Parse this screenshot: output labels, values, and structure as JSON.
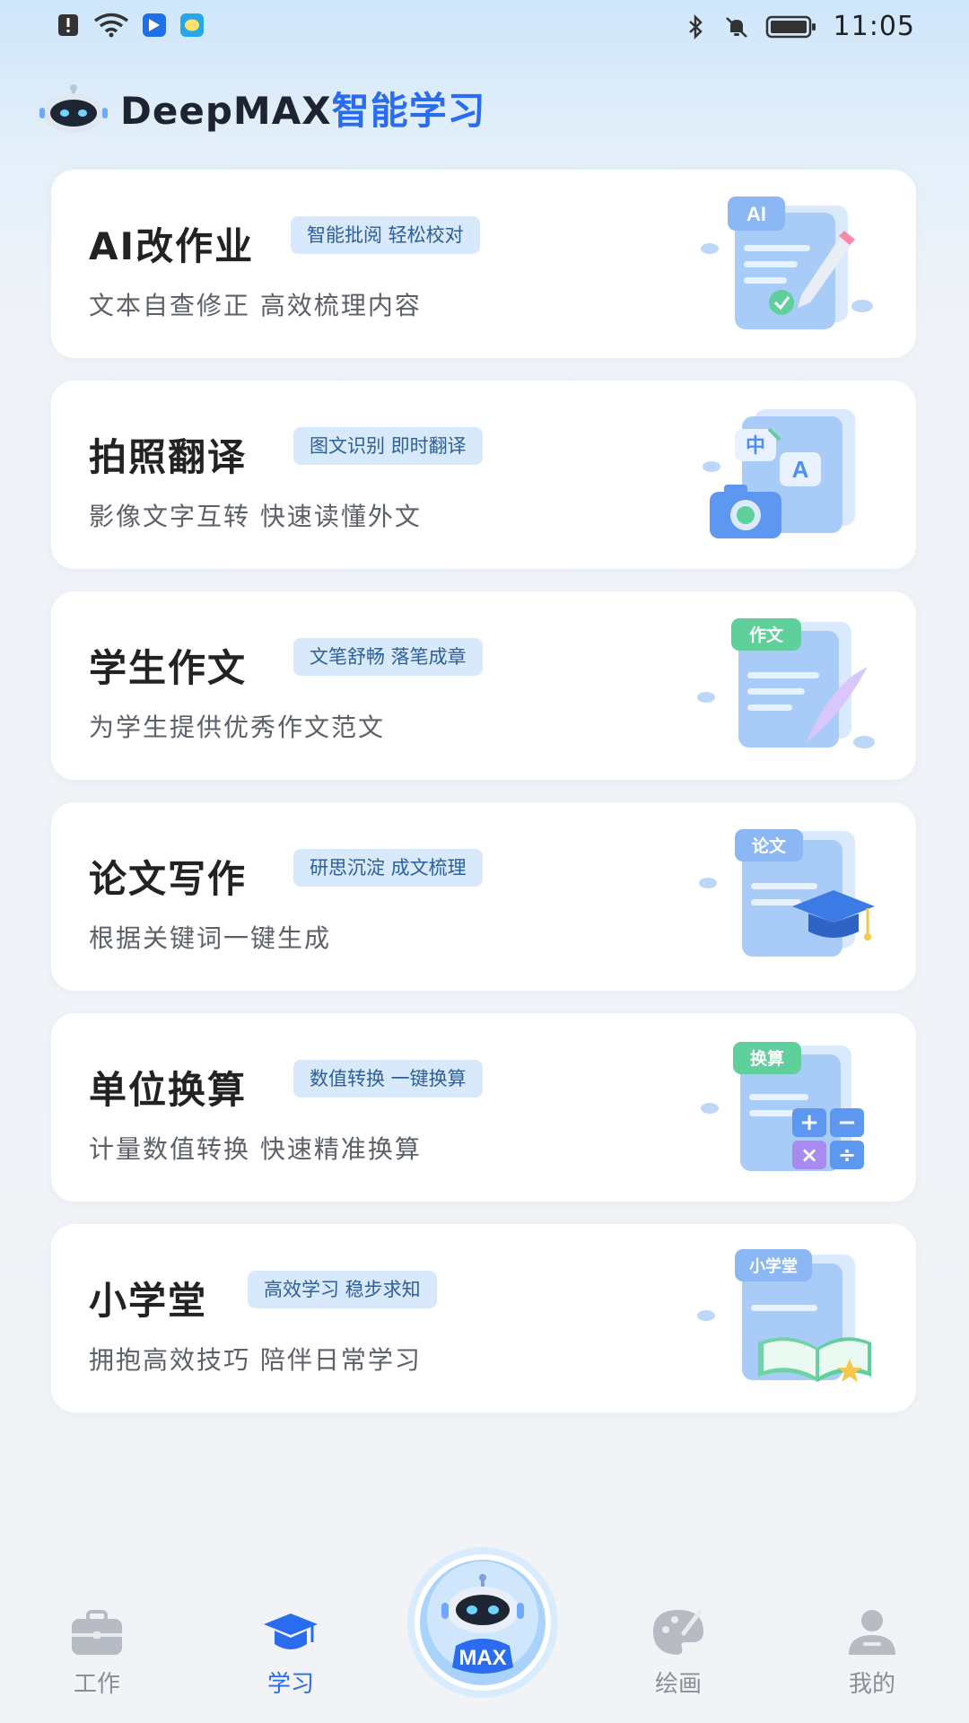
{
  "status_bar": {
    "time": "11:05",
    "left_icons": [
      "alert-icon",
      "wifi-icon",
      "app-notification-icon",
      "message-icon"
    ],
    "right_icons": [
      "bluetooth-icon",
      "mute-icon",
      "battery-icon"
    ]
  },
  "header": {
    "brand_latin": "DeepMAX",
    "brand_cn": "智能学习"
  },
  "cards": [
    {
      "title": "AI改作业",
      "badge": "智能批阅 轻松校对",
      "subtitle": "文本自查修正 高效梳理内容",
      "tag": "AI",
      "accent": "#4f8ff5"
    },
    {
      "title": "拍照翻译",
      "badge": "图文识别 即时翻译",
      "subtitle": "影像文字互转 快速读懂外文",
      "tag": "中 A",
      "accent": "#4f8ff5"
    },
    {
      "title": "学生作文",
      "badge": "文笔舒畅 落笔成章",
      "subtitle": "为学生提供优秀作文范文",
      "tag": "作文",
      "accent": "#57c49a"
    },
    {
      "title": "论文写作",
      "badge": "研思沉淀 成文梳理",
      "subtitle": "根据关键词一键生成",
      "tag": "论文",
      "accent": "#4f8ff5"
    },
    {
      "title": "单位换算",
      "badge": "数值转换 一键换算",
      "subtitle": "计量数值转换 快速精准换算",
      "tag": "换算",
      "accent": "#57c49a"
    },
    {
      "title": "小学堂",
      "badge": "高效学习 稳步求知",
      "subtitle": "拥抱高效技巧 陪伴日常学习",
      "tag": "小学堂",
      "accent": "#4f8ff5"
    }
  ],
  "nav": {
    "items": [
      {
        "label": "工作",
        "icon": "briefcase-icon",
        "active": false
      },
      {
        "label": "学习",
        "icon": "graduation-cap-icon",
        "active": true
      },
      {
        "label": "绘画",
        "icon": "palette-icon",
        "active": false
      },
      {
        "label": "我的",
        "icon": "user-icon",
        "active": false
      }
    ],
    "center_label": "MAX"
  },
  "colors": {
    "accent": "#2a6cf0",
    "badge_bg": "#d8e9fb",
    "badge_text": "#2d5f9a",
    "inactive_nav": "#8a8f97"
  }
}
